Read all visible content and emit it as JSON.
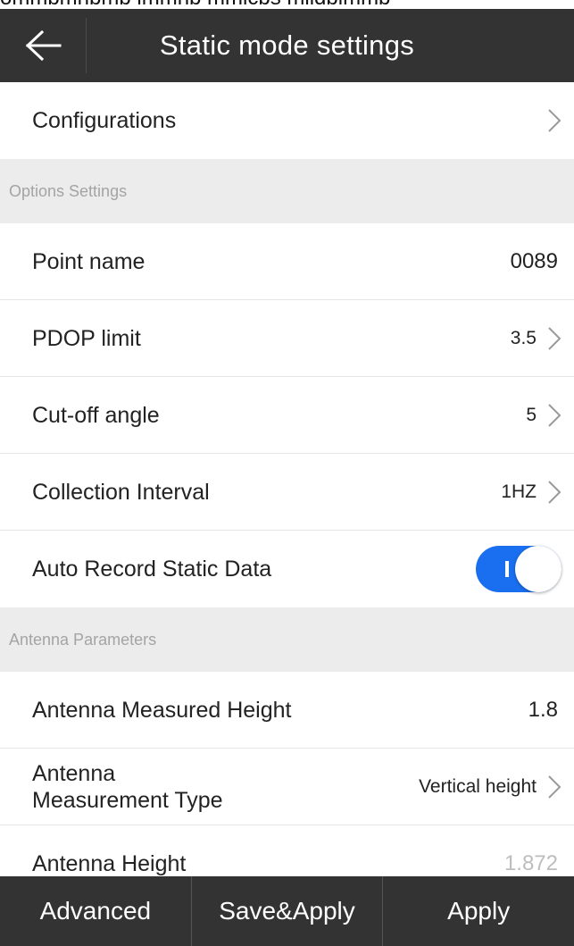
{
  "caption": "ommbmhbmb lmmhb mmlcbs mlldblmmb",
  "header": {
    "title": "Static mode settings",
    "back_icon": "arrow-left-icon"
  },
  "rows": {
    "configurations": {
      "label": "Configurations"
    },
    "point_name": {
      "label": "Point name",
      "value": "0089"
    },
    "pdop_limit": {
      "label": "PDOP limit",
      "value": "3.5"
    },
    "cutoff_angle": {
      "label": "Cut-off angle",
      "value": "5"
    },
    "collection_interval": {
      "label": "Collection Interval",
      "value": "1HZ"
    },
    "auto_record": {
      "label": "Auto Record Static Data",
      "toggle_on": true,
      "toggle_mark": "I"
    },
    "antenna_measured_height": {
      "label": "Antenna Measured Height",
      "value": "1.8"
    },
    "antenna_measurement_type": {
      "label_line1": "Antenna",
      "label_line2": "Measurement Type",
      "value": "Vertical height"
    },
    "antenna_height": {
      "label": "Antenna Height",
      "value": "1.872"
    }
  },
  "sections": {
    "options": "Options Settings",
    "antenna": "Antenna Parameters"
  },
  "bottom_bar": {
    "advanced": "Advanced",
    "save_apply": "Save&Apply",
    "apply": "Apply"
  },
  "colors": {
    "header_bg": "#333333",
    "section_bg": "#ececec",
    "toggle_on": "#1a6ff0"
  }
}
